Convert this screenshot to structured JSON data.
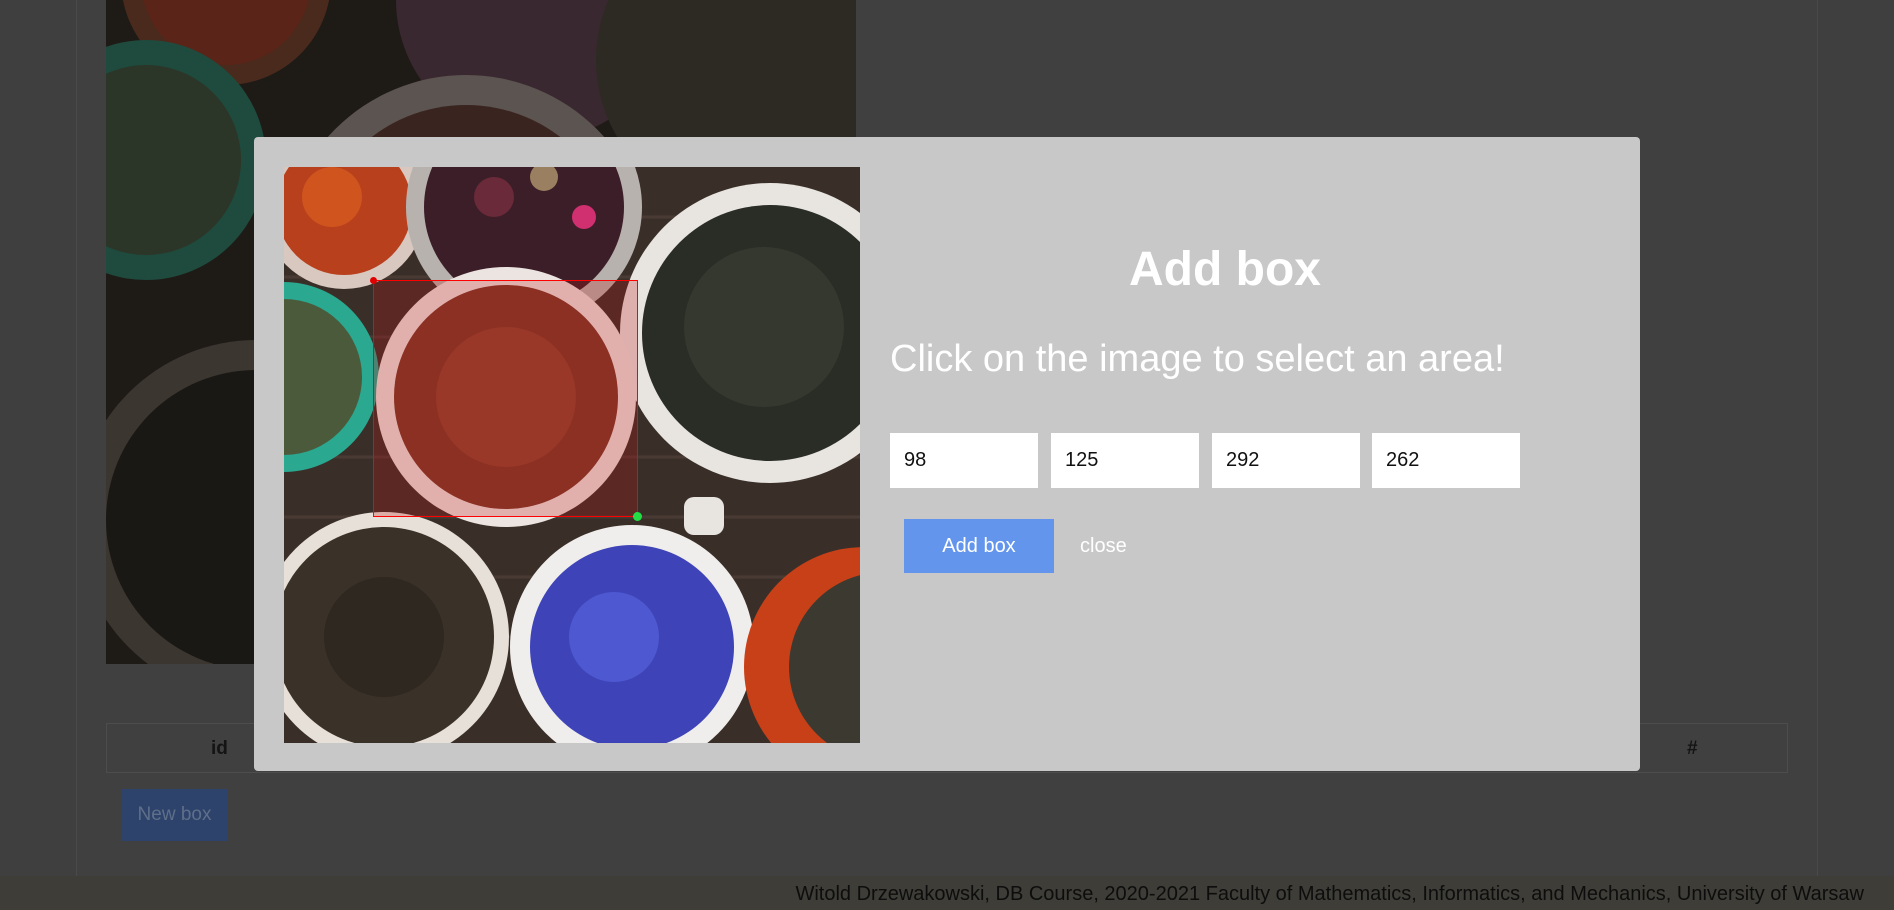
{
  "background": {
    "table_headers": {
      "id": "id",
      "actions": "#"
    },
    "new_box_label": "New box"
  },
  "footer": {
    "text": "Witold Drzewakowski, DB Course, 2020-2021 Faculty of Mathematics, Informatics, and Mechanics, University of Warsaw"
  },
  "modal": {
    "title": "Add box",
    "instruction": "Click on the image to select an area!",
    "coords": [
      "98",
      "125",
      "292",
      "262"
    ],
    "add_button": "Add box",
    "close_link": "close"
  },
  "colors": {
    "overlay_bg": "#3f3f3f",
    "modal_bg": "#c8c8c8",
    "primary_button": "#6495ed",
    "selection_border": "#ff0000",
    "end_handle": "#22dd44"
  },
  "icons": {
    "start_handle": "red-dot-icon",
    "end_handle": "green-dot-icon"
  }
}
